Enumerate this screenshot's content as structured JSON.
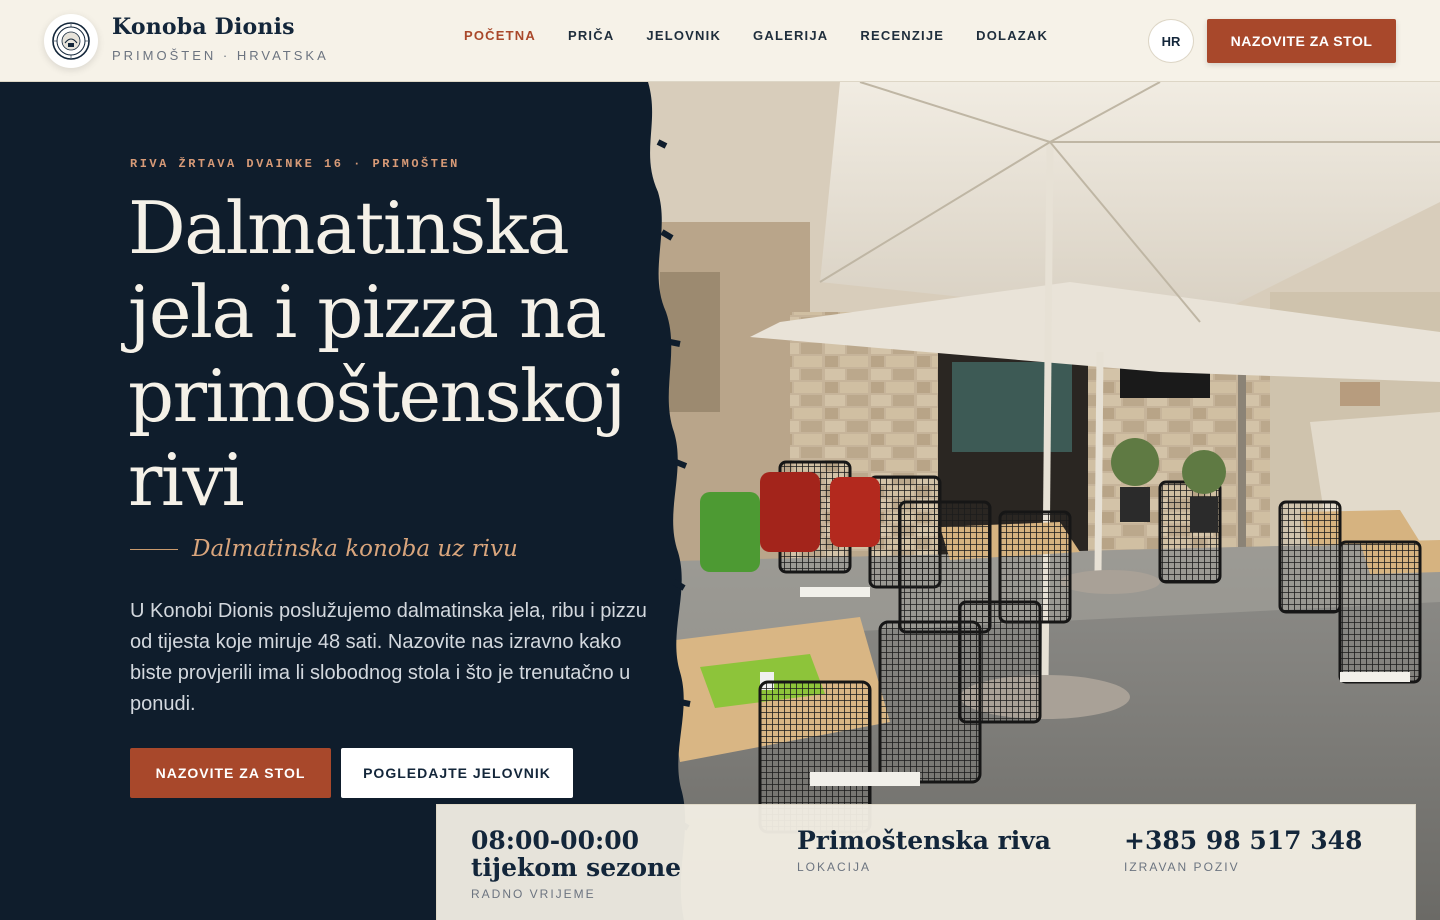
{
  "header": {
    "brand_name": "Konoba Dionis",
    "brand_sub": "PRIMOŠTEN · HRVATSKA",
    "nav": [
      {
        "label": "POČETNA",
        "active": true
      },
      {
        "label": "PRIČA"
      },
      {
        "label": "JELOVNIK"
      },
      {
        "label": "GALERIJA"
      },
      {
        "label": "RECENZIJE"
      },
      {
        "label": "DOLAZAK"
      }
    ],
    "lang": "HR",
    "cta": "NAZOVITE ZA STOL"
  },
  "hero": {
    "address": "RIVA ŽRTAVA DVAINKE 16 · PRIMOŠTEN",
    "title": "Dalmatinska jela i pizza na primoštenskoj rivi",
    "tagline": "Dalmatinska konoba uz rivu",
    "description": "U Konobi Dionis poslužujemo dalmatinska jela, ribu i pizzu od tijesta koje miruje 48 sati. Nazovite nas izravno kako biste provjerili ima li slobodnog stola i što je trenutačno u ponudi.",
    "primary_button": "NAZOVITE ZA STOL",
    "secondary_button": "POGLEDAJTE JELOVNIK"
  },
  "info": {
    "hours_value": "08:00-00:00 tijekom sezone",
    "hours_label": "RADNO VRIJEME",
    "location_value": "Primoštenska riva",
    "location_label": "LOKACIJA",
    "phone_value": "+385 98 517 348",
    "phone_label": "IZRAVAN POZIV"
  },
  "colors": {
    "navy": "#0f1d2c",
    "accent": "#a8482b",
    "cream": "#f6f2e8",
    "tagline": "#d9a57c"
  },
  "icons": {
    "logo": "round-seal-logo-icon"
  }
}
